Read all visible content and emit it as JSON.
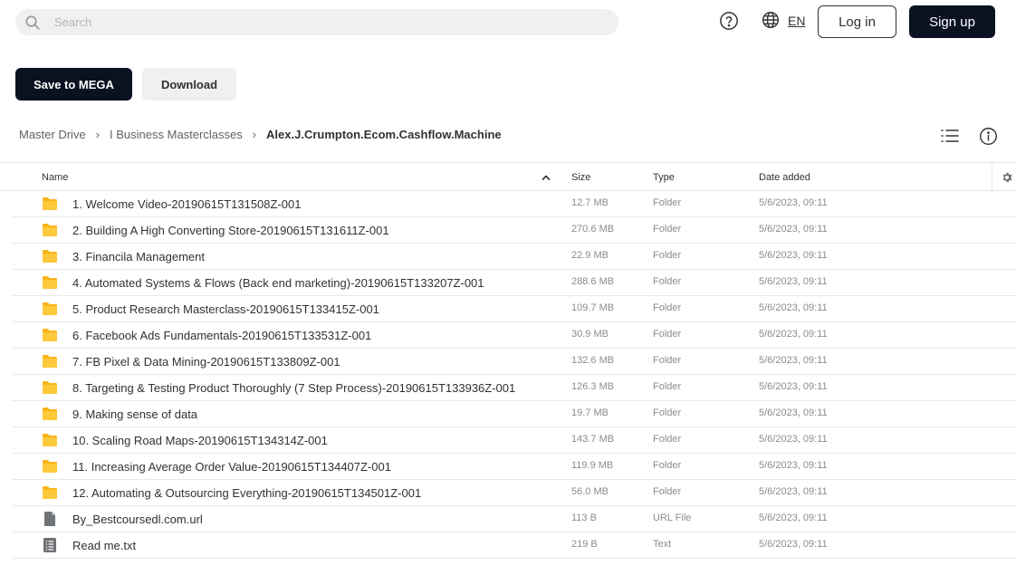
{
  "header": {
    "search_placeholder": "Search",
    "language": "EN",
    "login_label": "Log in",
    "signup_label": "Sign up"
  },
  "actions": {
    "save_label": "Save to MEGA",
    "download_label": "Download"
  },
  "breadcrumb": {
    "items": [
      "Master Drive",
      "I Business Masterclasses"
    ],
    "current": "Alex.J.Crumpton.Ecom.Cashflow.Machine"
  },
  "table": {
    "columns": {
      "name": "Name",
      "size": "Size",
      "type": "Type",
      "date": "Date added"
    },
    "rows": [
      {
        "icon": "folder-icon",
        "name": "1. Welcome Video-20190615T131508Z-001",
        "size": "12.7 MB",
        "type": "Folder",
        "date": "5/6/2023, 09:11"
      },
      {
        "icon": "folder-icon",
        "name": "2. Building A High Converting Store-20190615T131611Z-001",
        "size": "270.6 MB",
        "type": "Folder",
        "date": "5/6/2023, 09:11"
      },
      {
        "icon": "folder-icon",
        "name": "3. Financila Management",
        "size": "22.9 MB",
        "type": "Folder",
        "date": "5/6/2023, 09:11"
      },
      {
        "icon": "folder-icon",
        "name": "4. Automated Systems & Flows (Back end marketing)-20190615T133207Z-001",
        "size": "288.6 MB",
        "type": "Folder",
        "date": "5/6/2023, 09:11"
      },
      {
        "icon": "folder-icon",
        "name": "5. Product Research Masterclass-20190615T133415Z-001",
        "size": "109.7 MB",
        "type": "Folder",
        "date": "5/6/2023, 09:11"
      },
      {
        "icon": "folder-icon",
        "name": "6. Facebook Ads Fundamentals-20190615T133531Z-001",
        "size": "30.9 MB",
        "type": "Folder",
        "date": "5/6/2023, 09:11"
      },
      {
        "icon": "folder-icon",
        "name": "7. FB Pixel & Data Mining-20190615T133809Z-001",
        "size": "132.6 MB",
        "type": "Folder",
        "date": "5/6/2023, 09:11"
      },
      {
        "icon": "folder-icon",
        "name": "8. Targeting & Testing Product Thoroughly (7 Step Process)-20190615T133936Z-001",
        "size": "126.3 MB",
        "type": "Folder",
        "date": "5/6/2023, 09:11"
      },
      {
        "icon": "folder-icon",
        "name": "9. Making sense of data",
        "size": "19.7 MB",
        "type": "Folder",
        "date": "5/6/2023, 09:11"
      },
      {
        "icon": "folder-icon",
        "name": "10. Scaling Road Maps-20190615T134314Z-001",
        "size": "143.7 MB",
        "type": "Folder",
        "date": "5/6/2023, 09:11"
      },
      {
        "icon": "folder-icon",
        "name": "11. Increasing Average Order Value-20190615T134407Z-001",
        "size": "119.9 MB",
        "type": "Folder",
        "date": "5/6/2023, 09:11"
      },
      {
        "icon": "folder-icon",
        "name": "12. Automating & Outsourcing Everything-20190615T134501Z-001",
        "size": "56.0 MB",
        "type": "Folder",
        "date": "5/6/2023, 09:11"
      },
      {
        "icon": "url-file-icon",
        "name": "By_Bestcoursedl.com.url",
        "size": "113 B",
        "type": "URL File",
        "date": "5/6/2023, 09:11"
      },
      {
        "icon": "text-file-icon",
        "name": "Read me.txt",
        "size": "219 B",
        "type": "Text",
        "date": "5/6/2023, 09:11"
      }
    ]
  },
  "colors": {
    "primary_dark": "#0a1121",
    "folder_yellow": "#f9b41c",
    "file_gray": "#707376",
    "text": "#303233",
    "muted": "#8a8c8e"
  }
}
